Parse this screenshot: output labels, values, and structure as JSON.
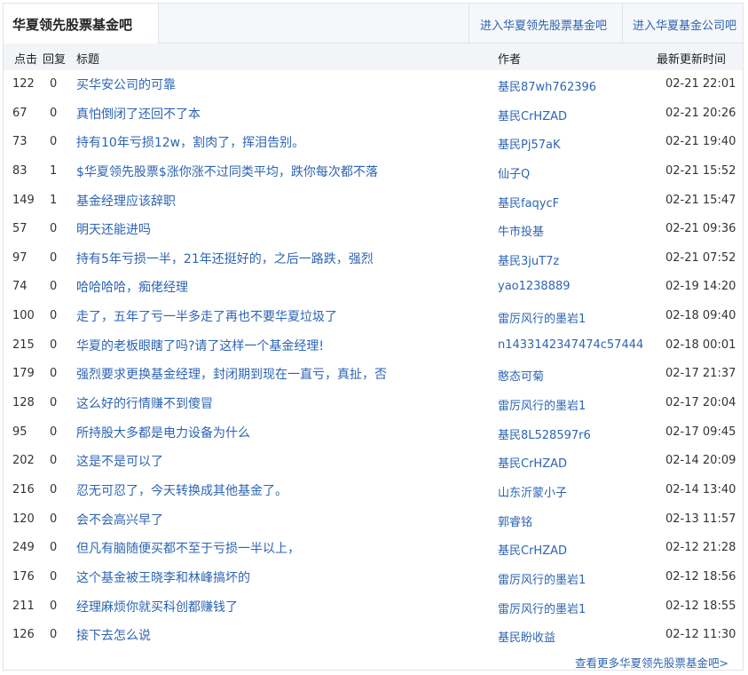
{
  "tabs": {
    "active": "华夏领先股票基金吧",
    "links": [
      "进入华夏领先股票基金吧",
      "进入华夏基金公司吧"
    ]
  },
  "columns": {
    "clicks": "点击",
    "replies": "回复",
    "title": "标题",
    "author": "作者",
    "updated": "最新更新时间"
  },
  "rows": [
    {
      "clicks": "122",
      "replies": "0",
      "title": "买华安公司的可靠",
      "author": "基民87wh762396",
      "time": "02-21 22:01"
    },
    {
      "clicks": "67",
      "replies": "0",
      "title": "真怕倒闭了还回不了本",
      "author": "基民CrHZAD",
      "time": "02-21 20:26"
    },
    {
      "clicks": "73",
      "replies": "0",
      "title": "持有10年亏损12w，割肉了，挥泪告别。",
      "author": "基民Pj57aK",
      "time": "02-21 19:40"
    },
    {
      "clicks": "83",
      "replies": "1",
      "title": "$华夏领先股票$涨你涨不过同类平均，跌你每次都不落",
      "author": "仙子Q",
      "time": "02-21 15:52"
    },
    {
      "clicks": "149",
      "replies": "1",
      "title": "基金经理应该辞职",
      "author": "基民faqycF",
      "time": "02-21 15:47"
    },
    {
      "clicks": "57",
      "replies": "0",
      "title": "明天还能进吗",
      "author": "牛市投基",
      "time": "02-21 09:36"
    },
    {
      "clicks": "97",
      "replies": "0",
      "title": "持有5年亏损一半，21年还挺好的，之后一路跌，强烈",
      "author": "基民3juT7z",
      "time": "02-21 07:52"
    },
    {
      "clicks": "74",
      "replies": "0",
      "title": "哈哈哈哈，痴佬经理",
      "author": "yao1238889",
      "time": "02-19 14:20"
    },
    {
      "clicks": "100",
      "replies": "0",
      "title": "走了，五年了亏一半多走了再也不要华夏垃圾了",
      "author": "雷厉风行的墨岩1",
      "time": "02-18 09:40"
    },
    {
      "clicks": "215",
      "replies": "0",
      "title": "华夏的老板眼瞎了吗?请了这样一个基金经理!",
      "author": "n1433142347474c57444",
      "time": "02-18 00:01"
    },
    {
      "clicks": "179",
      "replies": "0",
      "title": "强烈要求更换基金经理，封闭期到现在一直亏，真扯，否",
      "author": "憨态可菊",
      "time": "02-17 21:37"
    },
    {
      "clicks": "128",
      "replies": "0",
      "title": "这么好的行情赚不到傻冒",
      "author": "雷厉风行的墨岩1",
      "time": "02-17 20:04"
    },
    {
      "clicks": "95",
      "replies": "0",
      "title": "所持股大多都是电力设备为什么",
      "author": "基民8L528597r6",
      "time": "02-17 09:45"
    },
    {
      "clicks": "202",
      "replies": "0",
      "title": "这是不是可以了",
      "author": "基民CrHZAD",
      "time": "02-14 20:09"
    },
    {
      "clicks": "216",
      "replies": "0",
      "title": "忍无可忍了，今天转换成其他基金了。",
      "author": "山东沂蒙小子",
      "time": "02-14 13:40"
    },
    {
      "clicks": "120",
      "replies": "0",
      "title": "会不会高兴早了",
      "author": "郭睿铭",
      "time": "02-13 11:57"
    },
    {
      "clicks": "249",
      "replies": "0",
      "title": "但凡有脑随便买都不至于亏损一半以上，",
      "author": "基民CrHZAD",
      "time": "02-12 21:28"
    },
    {
      "clicks": "176",
      "replies": "0",
      "title": "这个基金被王晓李和林峰搞坏的",
      "author": "雷厉风行的墨岩1",
      "time": "02-12 18:56"
    },
    {
      "clicks": "211",
      "replies": "0",
      "title": "经理麻烦你就买科创都赚钱了",
      "author": "雷厉风行的墨岩1",
      "time": "02-12 18:55"
    },
    {
      "clicks": "126",
      "replies": "0",
      "title": "接下去怎么说",
      "author": "基民盼收益",
      "time": "02-12 11:30"
    }
  ],
  "footer": {
    "more_link": "查看更多华夏领先股票基金吧>"
  },
  "colors": {
    "link": "#2d64b3",
    "header_bg": "#f2f4f7",
    "tabbar_bg": "#f5f7fa"
  }
}
